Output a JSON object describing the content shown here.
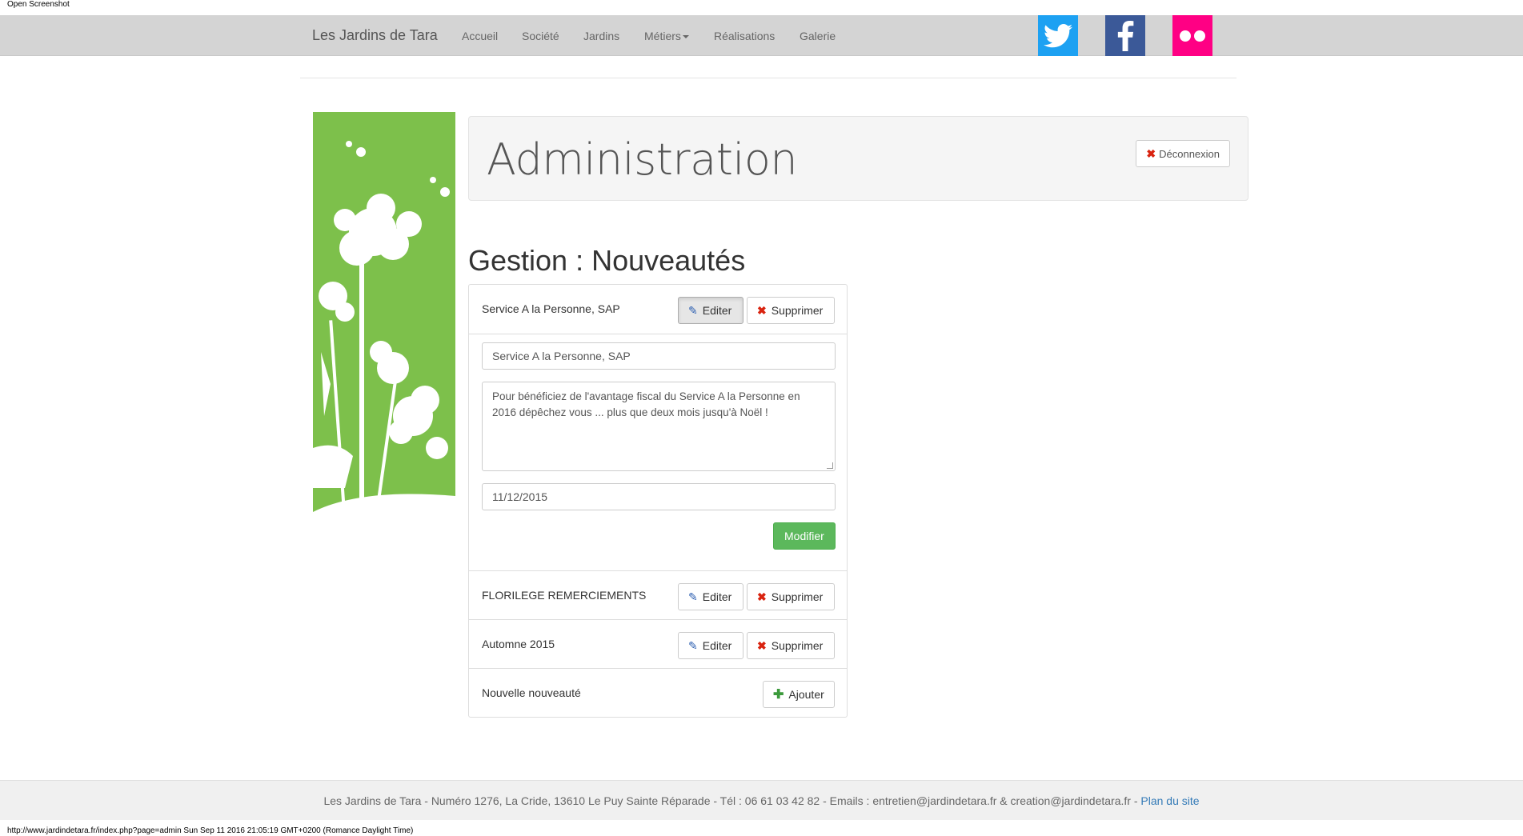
{
  "window": {
    "label": "Open Screenshot"
  },
  "nav": {
    "brand": "Les Jardins de Tara",
    "items": [
      "Accueil",
      "Société",
      "Jardins",
      "Métiers",
      "Réalisations",
      "Galerie"
    ]
  },
  "social": {
    "icons": [
      "twitter-icon",
      "facebook-icon",
      "flickr-icon"
    ]
  },
  "admin": {
    "title": "Administration",
    "logout_label": "Déconnexion"
  },
  "gestion": {
    "title": "Gestion : Nouveautés",
    "edit_label": "Editer",
    "delete_label": "Supprimer",
    "items": [
      {
        "label": "Service A la Personne, SAP"
      },
      {
        "label": "FLORILEGE REMERCIEMENTS"
      },
      {
        "label": "Automne 2015"
      }
    ],
    "form": {
      "title_value": "Service A la Personne, SAP",
      "description_value": "Pour bénéficiez de l'avantage fiscal du Service A la Personne en 2016 dépêchez vous ... plus que deux mois jusqu'à Noël !",
      "date_value": "11/12/2015",
      "save_label": "Modifier"
    },
    "new_item": {
      "label": "Nouvelle nouveauté",
      "add_label": "Ajouter"
    }
  },
  "footer": {
    "text": "Les Jardins de Tara - Numéro 1276, La Cride, 13610 Le Puy Sainte Réparade - Tél : 06 61 03 42 82 - Emails : entretien@jardindetara.fr & creation@jardindetara.fr - ",
    "link": "Plan du site"
  },
  "status_bar": "http://www.jardindetara.fr/index.php?page=admin Sun Sep 11 2016 21:05:19 GMT+0200 (Romance Daylight Time)",
  "colors": {
    "nav_bg": "#d4d4d4",
    "green": "#7dc04b",
    "success": "#5cb85c",
    "twitter": "#1da1f2",
    "facebook": "#3b5998",
    "flickr": "#ff0084"
  }
}
